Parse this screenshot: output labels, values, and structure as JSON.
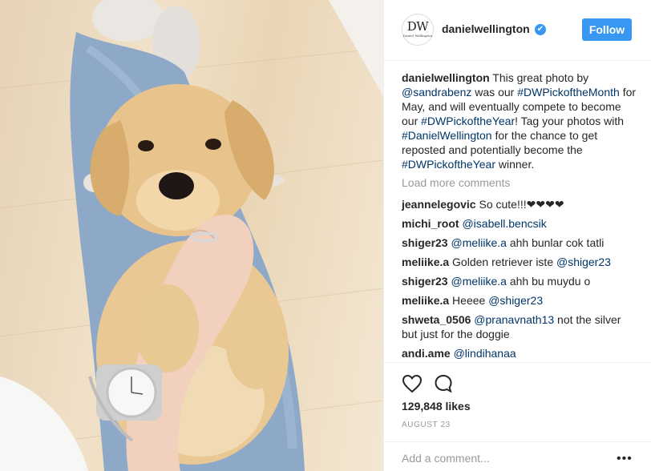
{
  "post": {
    "author": "danielwellington",
    "avatar_monogram": "DW",
    "avatar_subtitle": "Daniel Wellington",
    "follow_label": "Follow",
    "verified_glyph": "✔",
    "caption_segments": [
      {
        "text": "danielwellington",
        "type": "user"
      },
      {
        "text": " This great photo by ",
        "type": "text"
      },
      {
        "text": "@sandrabenz",
        "type": "tag"
      },
      {
        "text": " was our ",
        "type": "text"
      },
      {
        "text": "#DWPickoftheMonth",
        "type": "tag"
      },
      {
        "text": " for May, and will eventually compete to become our ",
        "type": "text"
      },
      {
        "text": "#DWPickoftheYear",
        "type": "tag"
      },
      {
        "text": "! Tag your photos with ",
        "type": "text"
      },
      {
        "text": "#DanielWellington",
        "type": "tag"
      },
      {
        "text": " for the chance to get reposted and potentially become the ",
        "type": "text"
      },
      {
        "text": "#DWPickoftheYear",
        "type": "tag"
      },
      {
        "text": " winner.",
        "type": "text"
      }
    ],
    "load_more": "Load more comments",
    "comments": [
      {
        "user": "jeannelegovic",
        "segments": [
          {
            "text": " So cute!!!❤❤❤❤",
            "type": "text"
          }
        ]
      },
      {
        "user": "michi_root",
        "segments": [
          {
            "text": " ",
            "type": "text"
          },
          {
            "text": "@isabell.bencsik",
            "type": "tag"
          }
        ]
      },
      {
        "user": "shiger23",
        "segments": [
          {
            "text": " ",
            "type": "text"
          },
          {
            "text": "@meliike.a",
            "type": "tag"
          },
          {
            "text": " ahh bunlar cok tatli",
            "type": "text"
          }
        ]
      },
      {
        "user": "meliike.a",
        "segments": [
          {
            "text": " Golden retriever iste ",
            "type": "text"
          },
          {
            "text": "@shiger23",
            "type": "tag"
          }
        ]
      },
      {
        "user": "shiger23",
        "segments": [
          {
            "text": " ",
            "type": "text"
          },
          {
            "text": "@meliike.a",
            "type": "tag"
          },
          {
            "text": " ahh bu muydu o",
            "type": "text"
          }
        ]
      },
      {
        "user": "meliike.a",
        "segments": [
          {
            "text": " Heeee ",
            "type": "text"
          },
          {
            "text": "@shiger23",
            "type": "tag"
          }
        ]
      },
      {
        "user": "shweta_0506",
        "segments": [
          {
            "text": " ",
            "type": "text"
          },
          {
            "text": "@pranavnath13",
            "type": "tag"
          },
          {
            "text": " not the silver but just for the doggie",
            "type": "text"
          }
        ]
      },
      {
        "user": "andi.ame",
        "segments": [
          {
            "text": " ",
            "type": "text"
          },
          {
            "text": "@lindihanaa",
            "type": "tag"
          }
        ]
      }
    ],
    "likes": "129,848 likes",
    "date": "AUGUST 23",
    "add_comment_placeholder": "Add a comment...",
    "more_glyph": "•••"
  },
  "icons": {
    "like": "heart-icon",
    "comment": "comment-bubble-icon",
    "verified": "verified-badge-icon",
    "more": "more-options-icon"
  },
  "colors": {
    "follow_button": "#3897f0",
    "tag_link": "#003569",
    "muted": "#999999"
  }
}
